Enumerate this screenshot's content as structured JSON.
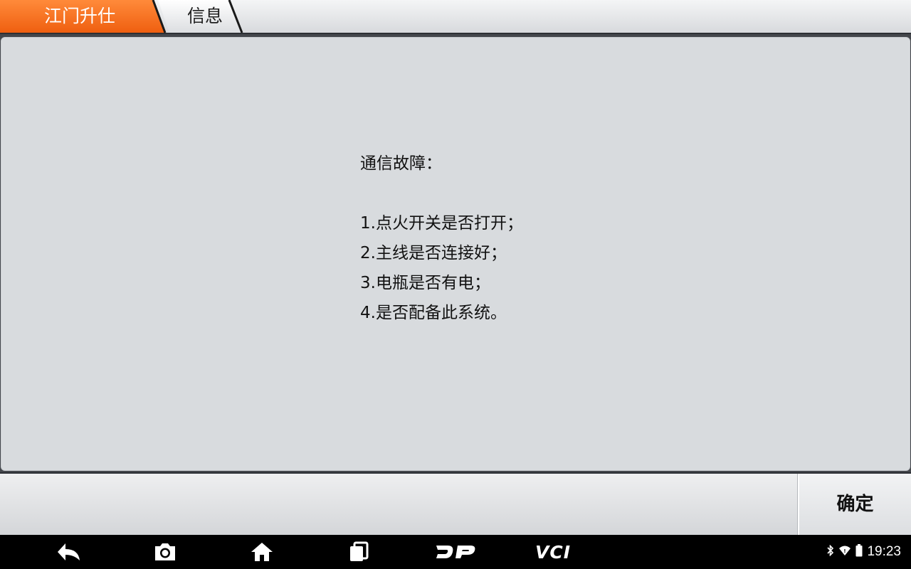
{
  "breadcrumb": {
    "home_label": "江门升仕",
    "current_label": "信息",
    "accent_color": "#f26b1d"
  },
  "message": {
    "title": "通信故障：",
    "items": [
      "1.点火开关是否打开；",
      "2.主线是否连接好；",
      "3.电瓶是否有电；",
      "4.是否配备此系统。"
    ]
  },
  "actions": {
    "confirm_label": "确定"
  },
  "system_bar": {
    "icons": [
      "back-icon",
      "screenshot-icon",
      "home-icon",
      "recent-apps-icon",
      "dp-logo-icon",
      "vci-icon"
    ],
    "vci_label": "VCI",
    "clock": "19:23",
    "status_icons": [
      "bluetooth-icon",
      "wifi-icon",
      "battery-icon"
    ]
  }
}
